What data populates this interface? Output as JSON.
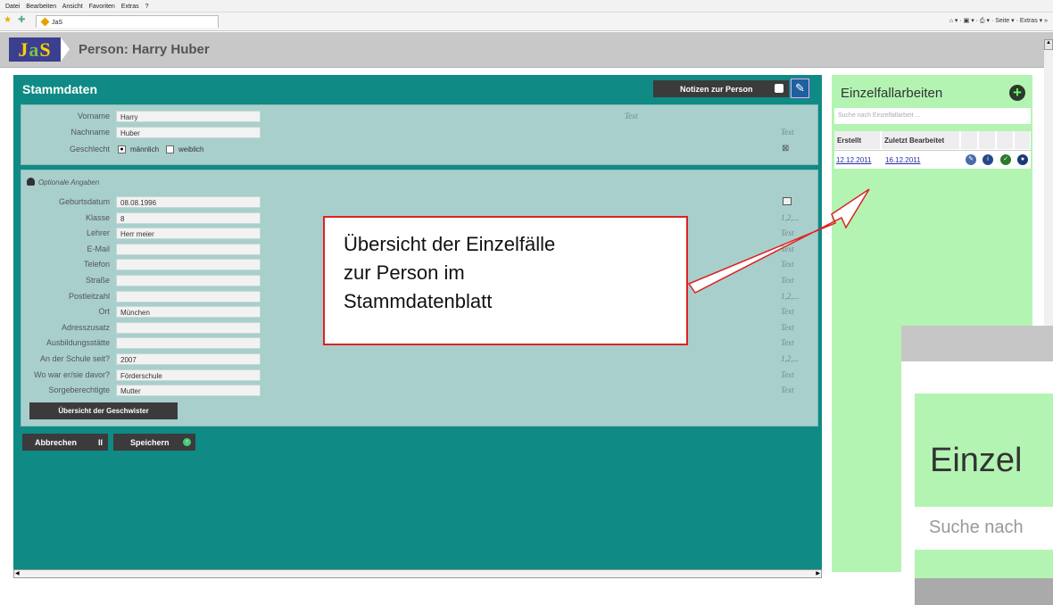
{
  "browser": {
    "menu": [
      "Datei",
      "Bearbeiten",
      "Ansicht",
      "Favoriten",
      "Extras",
      "?"
    ],
    "tab_title": "JaS",
    "tools": "Seite ▾ · Extras ▾"
  },
  "header": {
    "logo": "JaS",
    "title": "Person: Harry Huber"
  },
  "stammdaten": {
    "heading": "Stammdaten",
    "notes_button": "Notizen zur Person",
    "fields_main": [
      {
        "label": "Vorname",
        "value": "Harry",
        "hint": "Text"
      },
      {
        "label": "Nachname",
        "value": "Huber",
        "hint": "Text"
      }
    ],
    "gender": {
      "label": "Geschlecht",
      "option1": "männlich",
      "option2": "weiblich",
      "selected": "männlich"
    },
    "optional_label": "Optionale Angaben",
    "fields_optional": [
      {
        "label": "Geburtsdatum",
        "value": "08.08.1996",
        "hint": ""
      },
      {
        "label": "Klasse",
        "value": "8",
        "hint": "1,2,..."
      },
      {
        "label": "Lehrer",
        "value": "Herr meier",
        "hint": "Text"
      },
      {
        "label": "E-Mail",
        "value": "",
        "hint": "Text"
      },
      {
        "label": "Telefon",
        "value": "",
        "hint": "Text"
      },
      {
        "label": "Straße",
        "value": "",
        "hint": "Text"
      },
      {
        "label": "Postleitzahl",
        "value": "",
        "hint": "1,2,..."
      },
      {
        "label": "Ort",
        "value": "München",
        "hint": "Text"
      },
      {
        "label": "Adresszusatz",
        "value": "",
        "hint": "Text"
      },
      {
        "label": "Ausbildungsstätte",
        "value": "",
        "hint": "Text"
      },
      {
        "label": "An der Schule seit?",
        "value": "2007",
        "hint": "1,2,..."
      },
      {
        "label": "Wo war er/sie davor?",
        "value": "Förderschule",
        "hint": "Text"
      },
      {
        "label": "Sorgeberechtigte",
        "value": "Mutter",
        "hint": "Text"
      }
    ],
    "siblings_button": "Übersicht der Geschwister",
    "cancel_button": "Abbrechen",
    "save_button": "Speichern"
  },
  "einzelfall": {
    "title": "Einzelfallarbeiten",
    "search_placeholder": "Suche nach Einzelfallarbeit ...",
    "columns": [
      "Erstellt",
      "Zuletzt Bearbeitet"
    ],
    "rows": [
      {
        "created": "12.12.2011",
        "edited": "16.12.2011"
      }
    ]
  },
  "callout": {
    "line1": "Übersicht der Einzelfälle",
    "line2": "zur Person im",
    "line3": "Stammdatenblatt"
  },
  "zoom": {
    "title": "Einzel",
    "search": "Suche nach"
  },
  "colors": {
    "main_teal": "#0f8a84",
    "panel": "#a8cfcc",
    "side_green": "#b3f4b3",
    "callout_border": "#dd2222"
  }
}
